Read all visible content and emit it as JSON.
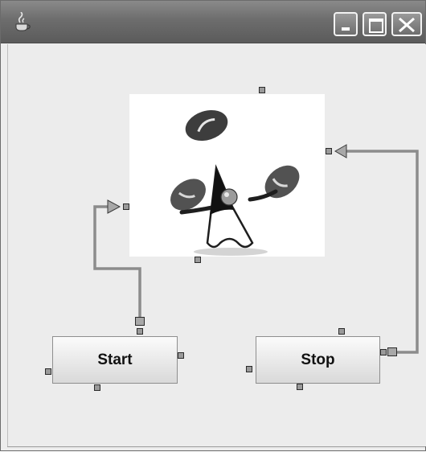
{
  "window": {
    "icon": "java-cup-icon",
    "controls": [
      "minimize-icon",
      "maximize-icon",
      "close-icon"
    ]
  },
  "canvas": {
    "image": "duke-juggling-beans",
    "connectors": [
      "start-to-image-connector",
      "stop-to-image-connector"
    ]
  },
  "nodes": {
    "start_label": "Start",
    "stop_label": "Stop"
  },
  "colors": {
    "titlebar": "#6d6d6d",
    "background": "#ececec",
    "connector": "#8c8c8c"
  }
}
